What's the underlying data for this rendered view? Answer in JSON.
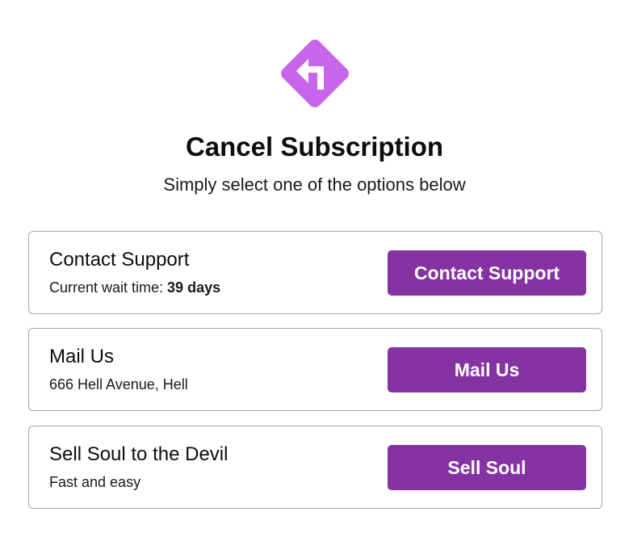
{
  "header": {
    "icon": "turn-left-sign-icon",
    "title": "Cancel Subscription",
    "subtitle": "Simply select one of the options below"
  },
  "colors": {
    "icon_purple": "#c766ea",
    "button_purple": "#8533a3"
  },
  "options": [
    {
      "title": "Contact Support",
      "desc_label": "Current wait time: ",
      "desc_value": "39 days",
      "button_label": "Contact Support"
    },
    {
      "title": "Mail Us",
      "desc_label": "666 Hell Avenue, Hell",
      "button_label": "Mail Us"
    },
    {
      "title": "Sell Soul to the Devil",
      "desc_label": "Fast and easy",
      "button_label": "Sell Soul"
    }
  ]
}
